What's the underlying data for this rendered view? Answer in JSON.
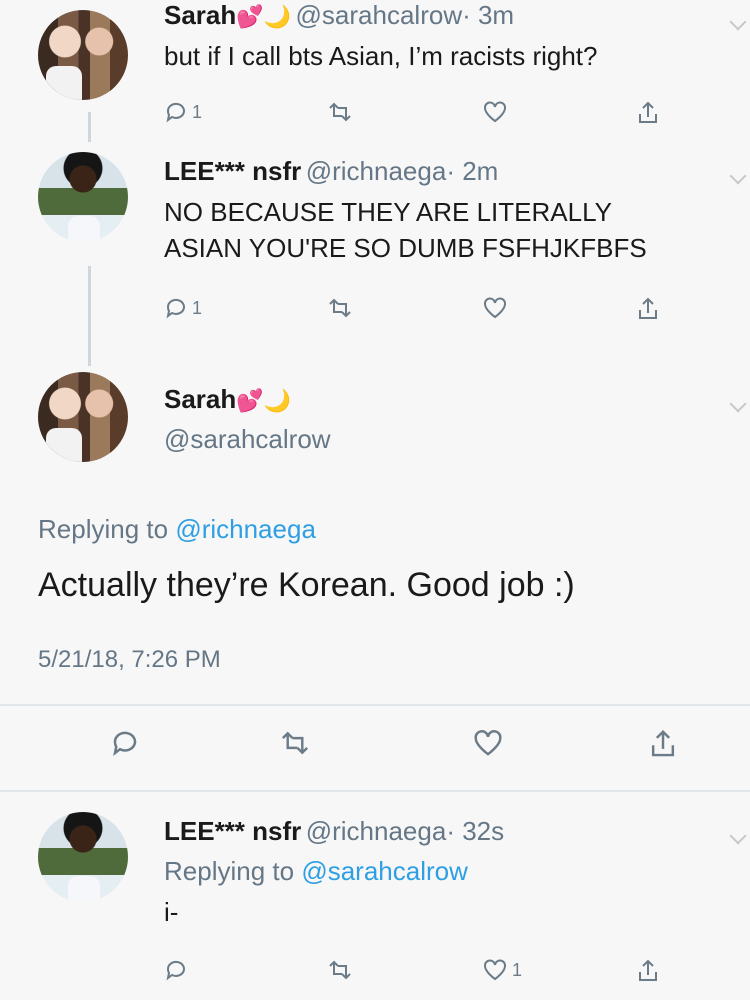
{
  "tweets": [
    {
      "name": "Sarah",
      "emojis": [
        "💕",
        "🌙"
      ],
      "handle": "@sarahcalrow",
      "time": "· 3m",
      "text": "but if I call bts Asian, I’m racists right?",
      "reply_count": "1"
    },
    {
      "name": "LEE*** nsfr",
      "handle": "@richnaega",
      "time": "· 2m",
      "text_line1": "NO BECAUSE THEY ARE LITERALLY",
      "text_line2": "ASIAN YOU'RE SO DUMB FSFHJKFBFS",
      "reply_count": "1"
    }
  ],
  "focused": {
    "name": "Sarah",
    "emojis": [
      "💕",
      "🌙"
    ],
    "handle": "@sarahcalrow",
    "replying_prefix": "Replying to ",
    "replying_handle": "@richnaega",
    "text": "Actually they’re Korean. Good job :)",
    "timestamp": "5/21/18, 7:26 PM"
  },
  "reply": {
    "name": "LEE*** nsfr",
    "handle": "@richnaega",
    "time": "· 32s",
    "replying_prefix": "Replying to ",
    "replying_handle": "@sarahcalrow",
    "text": "i-",
    "like_count": "1"
  },
  "colors": {
    "link": "#2f9fe3",
    "muted": "#657786",
    "background": "#f7f7f7"
  }
}
